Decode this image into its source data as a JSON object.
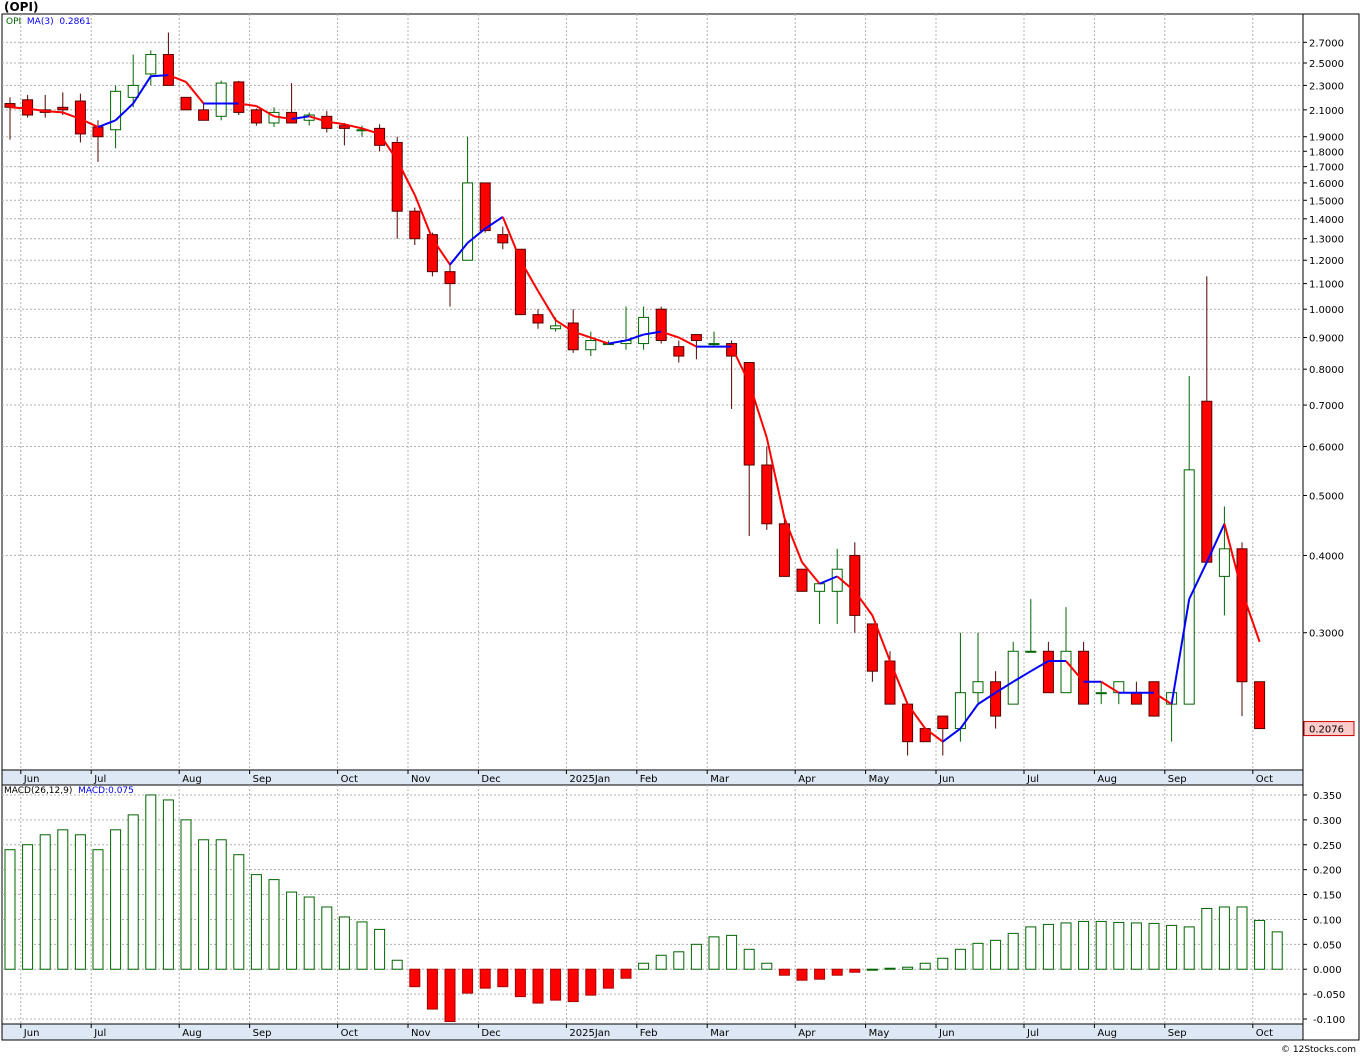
{
  "title": "(OPI)",
  "legend": {
    "symbol": "OPI",
    "ma_label": "MA(3)",
    "ma_value": "0.2861",
    "macd_label": "MACD(26,12,9)",
    "macd_name": "MACD:",
    "macd_value": "0.075"
  },
  "last_price_label": "0.2076",
  "credit": "© 12Stocks.com",
  "colors": {
    "up": "#006400",
    "down": "#ff0000",
    "ma_up": "#0000ff",
    "ma_down": "#ff0000",
    "price_badge": "#ffcccc",
    "grid": "#b0b0b0"
  },
  "chart_data": [
    {
      "type": "candlestick",
      "scale": "log",
      "ylim": [
        0.18,
        3.0
      ],
      "ytick_labels": [
        "2.7000",
        "2.5000",
        "2.3000",
        "2.1000",
        "1.9000",
        "1.8000",
        "1.7000",
        "1.6000",
        "1.5000",
        "1.4000",
        "1.3000",
        "1.2000",
        "1.1000",
        "1.0000",
        "0.9000",
        "0.8000",
        "0.7000",
        "0.6000",
        "0.5000",
        "0.4000",
        "0.3000"
      ],
      "xtick_labels": [
        "Jun",
        "Jul",
        "Aug",
        "Sep",
        "Oct",
        "Nov",
        "Dec",
        "2025Jan",
        "Feb",
        "Mar",
        "Apr",
        "May",
        "Jun",
        "Jul",
        "Aug",
        "Sep",
        "Oct"
      ],
      "xtick_index": [
        1,
        5,
        10,
        14,
        19,
        23,
        27,
        32,
        36,
        40,
        45,
        49,
        53,
        58,
        62,
        66,
        71
      ],
      "ohlc": [
        [
          2.15,
          2.2,
          1.88,
          2.12
        ],
        [
          2.18,
          2.22,
          2.04,
          2.06
        ],
        [
          2.1,
          2.22,
          2.04,
          2.08
        ],
        [
          2.12,
          2.24,
          2.06,
          2.1
        ],
        [
          2.17,
          2.23,
          1.86,
          1.92
        ],
        [
          1.97,
          2.02,
          1.73,
          1.9
        ],
        [
          1.95,
          2.3,
          1.82,
          2.25
        ],
        [
          2.2,
          2.58,
          2.12,
          2.3
        ],
        [
          2.4,
          2.62,
          2.3,
          2.58
        ],
        [
          2.58,
          2.8,
          2.3,
          2.3
        ],
        [
          2.2,
          2.2,
          2.1,
          2.1
        ],
        [
          2.1,
          2.16,
          2.02,
          2.02
        ],
        [
          2.05,
          2.34,
          2.02,
          2.32
        ],
        [
          2.33,
          2.34,
          2.06,
          2.08
        ],
        [
          2.1,
          2.11,
          1.98,
          2.0
        ],
        [
          2.0,
          2.12,
          1.97,
          2.08
        ],
        [
          2.08,
          2.32,
          2.0,
          2.0
        ],
        [
          2.02,
          2.08,
          1.98,
          2.06
        ],
        [
          2.05,
          2.09,
          1.93,
          1.96
        ],
        [
          1.98,
          2.0,
          1.84,
          1.96
        ],
        [
          1.95,
          1.98,
          1.9,
          1.95
        ],
        [
          1.96,
          1.99,
          1.8,
          1.84
        ],
        [
          1.86,
          1.9,
          1.3,
          1.44
        ],
        [
          1.44,
          1.46,
          1.27,
          1.3
        ],
        [
          1.32,
          1.33,
          1.13,
          1.15
        ],
        [
          1.15,
          1.19,
          1.01,
          1.1
        ],
        [
          1.2,
          1.9,
          1.2,
          1.6
        ],
        [
          1.6,
          1.6,
          1.33,
          1.34
        ],
        [
          1.32,
          1.36,
          1.25,
          1.28
        ],
        [
          1.25,
          1.25,
          0.98,
          0.98
        ],
        [
          0.98,
          1.0,
          0.93,
          0.95
        ],
        [
          0.93,
          0.97,
          0.92,
          0.94
        ],
        [
          0.95,
          1.0,
          0.85,
          0.86
        ],
        [
          0.86,
          0.92,
          0.84,
          0.89
        ],
        [
          0.88,
          0.89,
          0.88,
          0.88
        ],
        [
          0.88,
          1.01,
          0.86,
          0.89
        ],
        [
          0.88,
          1.01,
          0.86,
          0.97
        ],
        [
          1.0,
          1.01,
          0.88,
          0.89
        ],
        [
          0.87,
          0.89,
          0.82,
          0.84
        ],
        [
          0.91,
          0.91,
          0.83,
          0.89
        ],
        [
          0.88,
          0.92,
          0.87,
          0.88
        ],
        [
          0.88,
          0.89,
          0.69,
          0.84
        ],
        [
          0.82,
          0.82,
          0.43,
          0.56
        ],
        [
          0.56,
          0.6,
          0.44,
          0.45
        ],
        [
          0.45,
          0.46,
          0.37,
          0.37
        ],
        [
          0.38,
          0.38,
          0.35,
          0.35
        ],
        [
          0.35,
          0.36,
          0.31,
          0.36
        ],
        [
          0.35,
          0.41,
          0.31,
          0.38
        ],
        [
          0.4,
          0.42,
          0.3,
          0.32
        ],
        [
          0.31,
          0.31,
          0.25,
          0.26
        ],
        [
          0.27,
          0.28,
          0.23,
          0.23
        ],
        [
          0.23,
          0.23,
          0.19,
          0.2
        ],
        [
          0.21,
          0.21,
          0.2,
          0.2
        ],
        [
          0.22,
          0.22,
          0.19,
          0.21
        ],
        [
          0.21,
          0.3,
          0.2,
          0.24
        ],
        [
          0.24,
          0.3,
          0.23,
          0.25
        ],
        [
          0.25,
          0.26,
          0.21,
          0.22
        ],
        [
          0.23,
          0.29,
          0.23,
          0.28
        ],
        [
          0.28,
          0.34,
          0.28,
          0.28
        ],
        [
          0.28,
          0.29,
          0.24,
          0.24
        ],
        [
          0.24,
          0.33,
          0.24,
          0.28
        ],
        [
          0.28,
          0.29,
          0.23,
          0.23
        ],
        [
          0.24,
          0.25,
          0.23,
          0.24
        ],
        [
          0.24,
          0.25,
          0.23,
          0.25
        ],
        [
          0.24,
          0.25,
          0.23,
          0.23
        ],
        [
          0.25,
          0.25,
          0.22,
          0.22
        ],
        [
          0.23,
          0.24,
          0.2,
          0.24
        ],
        [
          0.23,
          0.78,
          0.23,
          0.55
        ],
        [
          0.71,
          1.13,
          0.39,
          0.39
        ],
        [
          0.37,
          0.48,
          0.32,
          0.41
        ],
        [
          0.41,
          0.42,
          0.22,
          0.25
        ],
        [
          0.25,
          0.25,
          0.21,
          0.21
        ]
      ],
      "ma3": [
        2.12,
        2.11,
        2.09,
        2.08,
        2.03,
        1.97,
        2.02,
        2.15,
        2.38,
        2.39,
        2.33,
        2.15,
        2.15,
        2.15,
        2.13,
        2.05,
        2.03,
        2.05,
        2.01,
        1.99,
        1.96,
        1.92,
        1.74,
        1.53,
        1.3,
        1.18,
        1.28,
        1.35,
        1.41,
        1.2,
        1.07,
        0.96,
        0.92,
        0.9,
        0.88,
        0.89,
        0.91,
        0.92,
        0.9,
        0.87,
        0.87,
        0.87,
        0.76,
        0.62,
        0.46,
        0.39,
        0.36,
        0.37,
        0.35,
        0.32,
        0.27,
        0.23,
        0.21,
        0.2,
        0.21,
        0.23,
        0.24,
        0.25,
        0.26,
        0.27,
        0.27,
        0.25,
        0.25,
        0.24,
        0.24,
        0.24,
        0.23,
        0.34,
        0.39,
        0.45,
        0.35,
        0.29
      ]
    },
    {
      "type": "bar",
      "name": "MACD",
      "ylim": [
        -0.11,
        0.37
      ],
      "ytick_labels": [
        "0.350",
        "0.300",
        "0.250",
        "0.200",
        "0.150",
        "0.100",
        "0.050",
        "0.000",
        "-0.050",
        "-0.100"
      ],
      "values": [
        0.24,
        0.25,
        0.27,
        0.28,
        0.27,
        0.24,
        0.28,
        0.31,
        0.35,
        0.34,
        0.3,
        0.26,
        0.26,
        0.23,
        0.19,
        0.18,
        0.155,
        0.145,
        0.125,
        0.105,
        0.095,
        0.08,
        0.018,
        -0.035,
        -0.08,
        -0.105,
        -0.048,
        -0.038,
        -0.035,
        -0.055,
        -0.068,
        -0.062,
        -0.065,
        -0.052,
        -0.038,
        -0.018,
        0.012,
        0.028,
        0.035,
        0.05,
        0.065,
        0.068,
        0.04,
        0.012,
        -0.012,
        -0.022,
        -0.02,
        -0.012,
        -0.006,
        0.0,
        0.002,
        0.004,
        0.012,
        0.022,
        0.04,
        0.052,
        0.058,
        0.072,
        0.085,
        0.09,
        0.093,
        0.096,
        0.096,
        0.094,
        0.093,
        0.092,
        0.088,
        0.085,
        0.122,
        0.125,
        0.125,
        0.098,
        0.075
      ]
    }
  ]
}
